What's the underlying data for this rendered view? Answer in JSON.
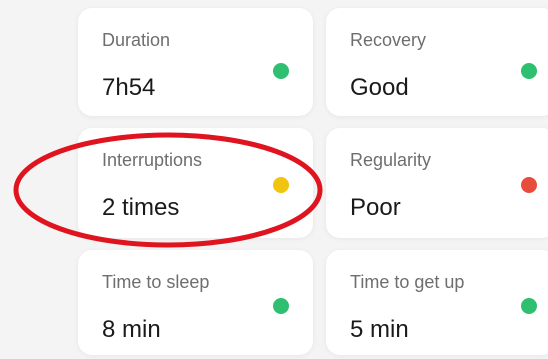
{
  "metrics": [
    {
      "label": "Duration",
      "value": "7h54",
      "status": "green"
    },
    {
      "label": "Recovery",
      "value": "Good",
      "status": "green"
    },
    {
      "label": "Interruptions",
      "value": "2 times",
      "status": "yellow"
    },
    {
      "label": "Regularity",
      "value": "Poor",
      "status": "red"
    },
    {
      "label": "Time to sleep",
      "value": "8 min",
      "status": "green"
    },
    {
      "label": "Time to get up",
      "value": "5 min",
      "status": "green"
    }
  ],
  "colors": {
    "good": "#2fbf71",
    "warning": "#f1c40f",
    "bad": "#e74c3c",
    "annotation": "#e0141e"
  },
  "annotation": {
    "shape": "ellipse",
    "highlighted_metric": "Interruptions"
  }
}
